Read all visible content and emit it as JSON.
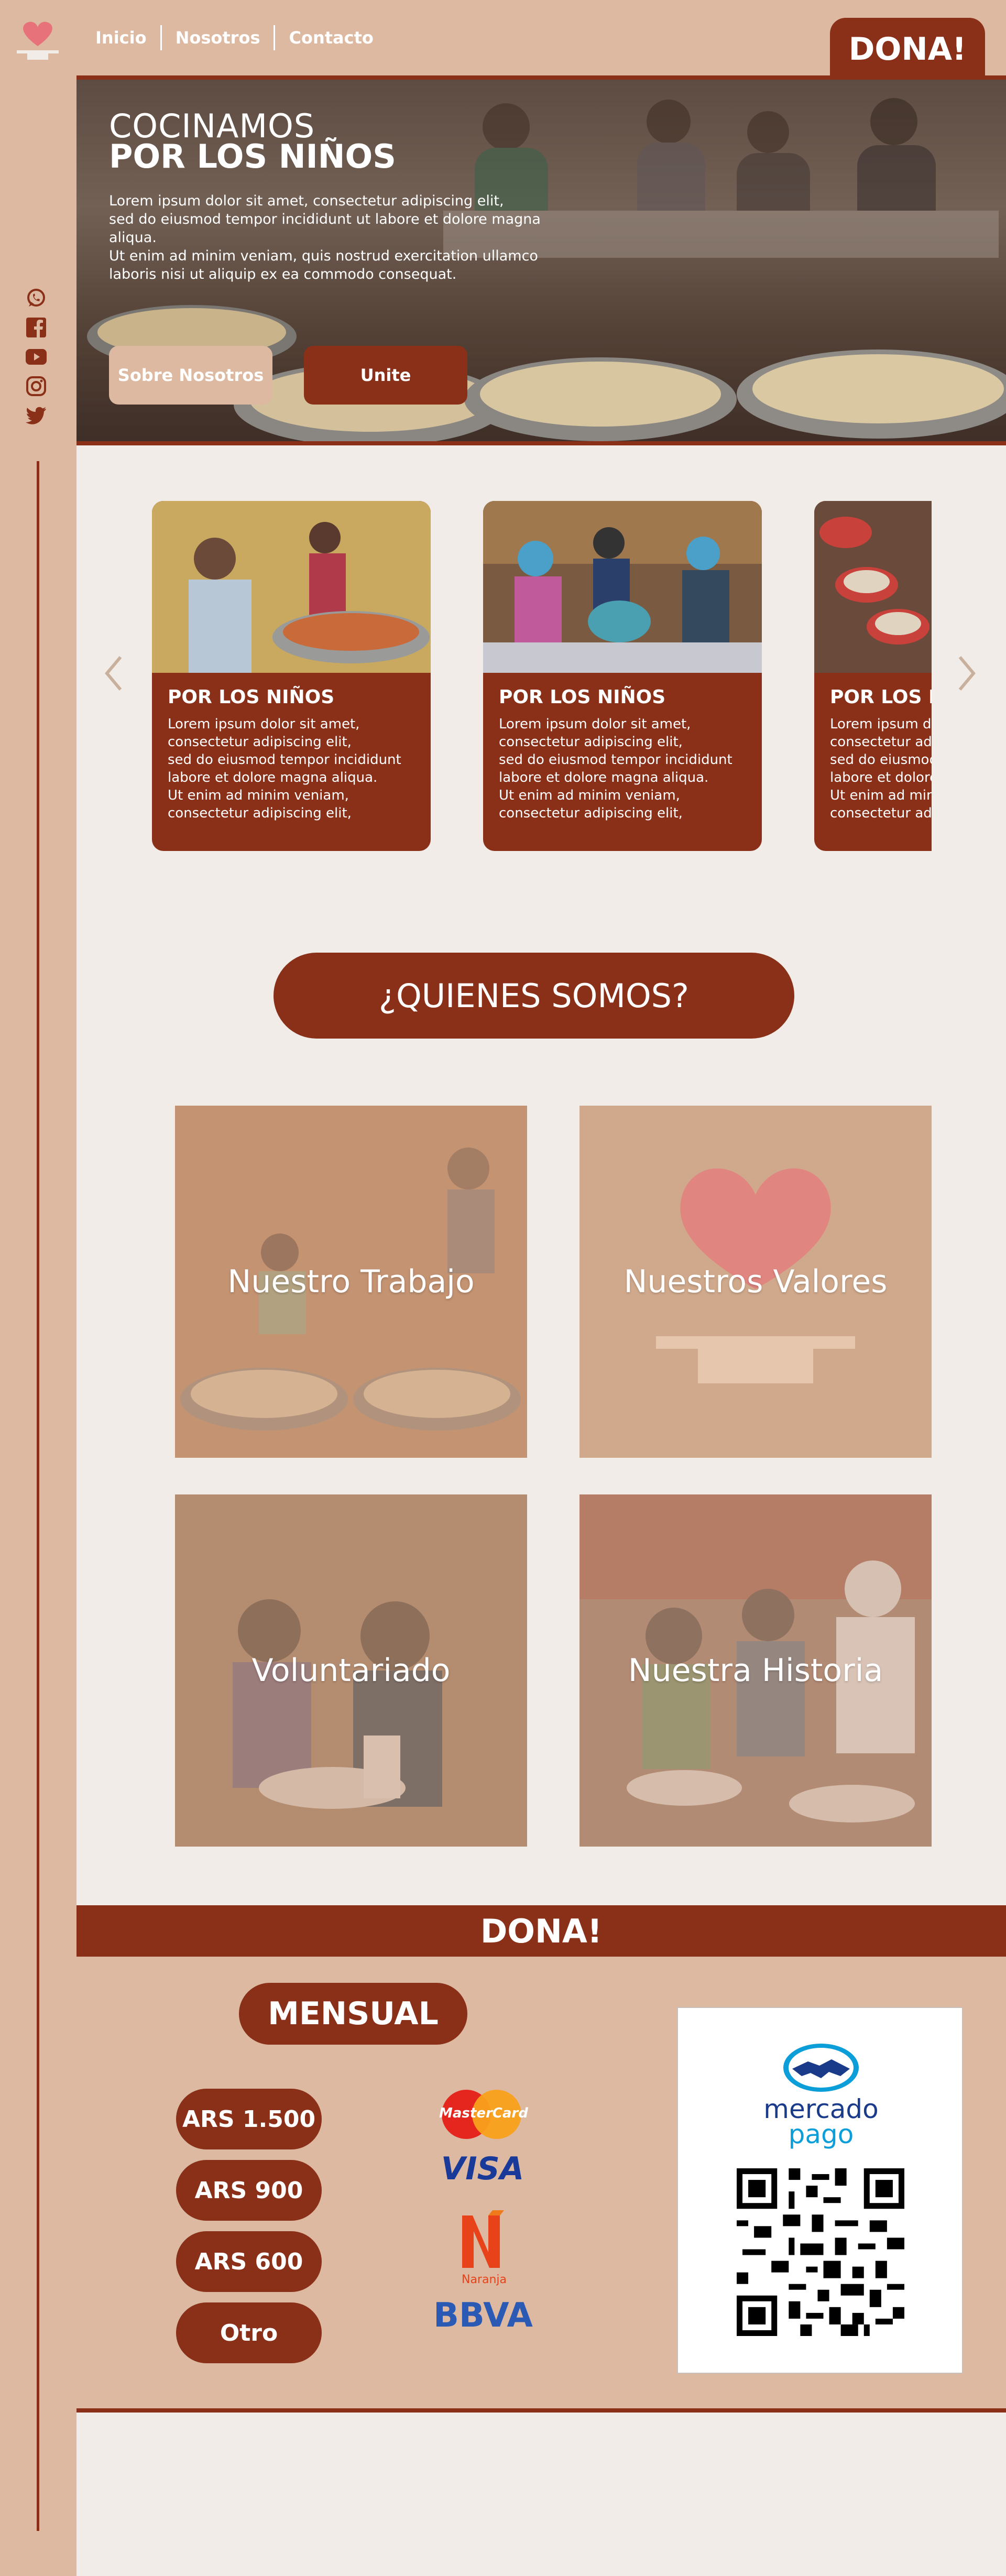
{
  "nav": {
    "links": [
      "Inicio",
      "Nosotros",
      "Contacto"
    ],
    "donate_label": "DONA!"
  },
  "social": [
    "whatsapp-icon",
    "facebook-icon",
    "youtube-icon",
    "instagram-icon",
    "twitter-icon"
  ],
  "hero": {
    "title_line1": "COCINAMOS",
    "title_line2": "POR LOS NIÑOS",
    "text": "Lorem ipsum dolor sit amet, consectetur adipiscing elit,\nsed do eiusmod tempor incididunt ut labore et dolore magna aliqua.\nUt enim ad minim veniam, quis nostrud exercitation ullamco\nlaboris nisi ut aliquip ex ea commodo consequat.",
    "btn_about": "Sobre Nosotros",
    "btn_join": "Unite"
  },
  "cards": [
    {
      "title": "POR LOS NIÑOS",
      "text": "Lorem ipsum dolor sit amet,\nconsectetur adipiscing elit,\nsed do eiusmod tempor incididunt\nlabore et dolore magna aliqua.\nUt enim ad minim veniam,\nconsectetur adipiscing elit,"
    },
    {
      "title": "POR LOS NIÑOS",
      "text": "Lorem ipsum dolor sit amet,\nconsectetur adipiscing elit,\nsed do eiusmod tempor incididunt\nlabore et dolore magna aliqua.\nUt enim ad minim veniam,\nconsectetur adipiscing elit,"
    },
    {
      "title": "POR LOS NIÑOS",
      "text": "Lorem ipsum dolor sit amet,\nconsectetur adipiscing elit,\nsed do eiusmod tempor incididunt\nlabore et dolore magna aliqua.\nUt enim ad minim veniam,\nconsectetur adipiscing elit,"
    }
  ],
  "quienes": {
    "heading": "¿QUIENES SOMOS?",
    "tiles": [
      "Nuestro Trabajo",
      "Nuestros Valores",
      "Voluntariado",
      "Nuestra Historia"
    ]
  },
  "donate": {
    "heading": "DONA!",
    "monthly_label": "MENSUAL",
    "amounts": [
      "ARS 1.500",
      "ARS  900",
      "ARS  600",
      "Otro"
    ],
    "payment_methods": {
      "mastercard": "MasterCard",
      "visa": "VISA",
      "naranja": "Naranja",
      "bbva": "BBVA"
    },
    "mercadopago_line1": "mercado",
    "mercadopago_line2": "pago"
  },
  "colors": {
    "accent": "#8a2f18",
    "sidebar": "#dcb9a0",
    "background": "#f1ece7"
  }
}
